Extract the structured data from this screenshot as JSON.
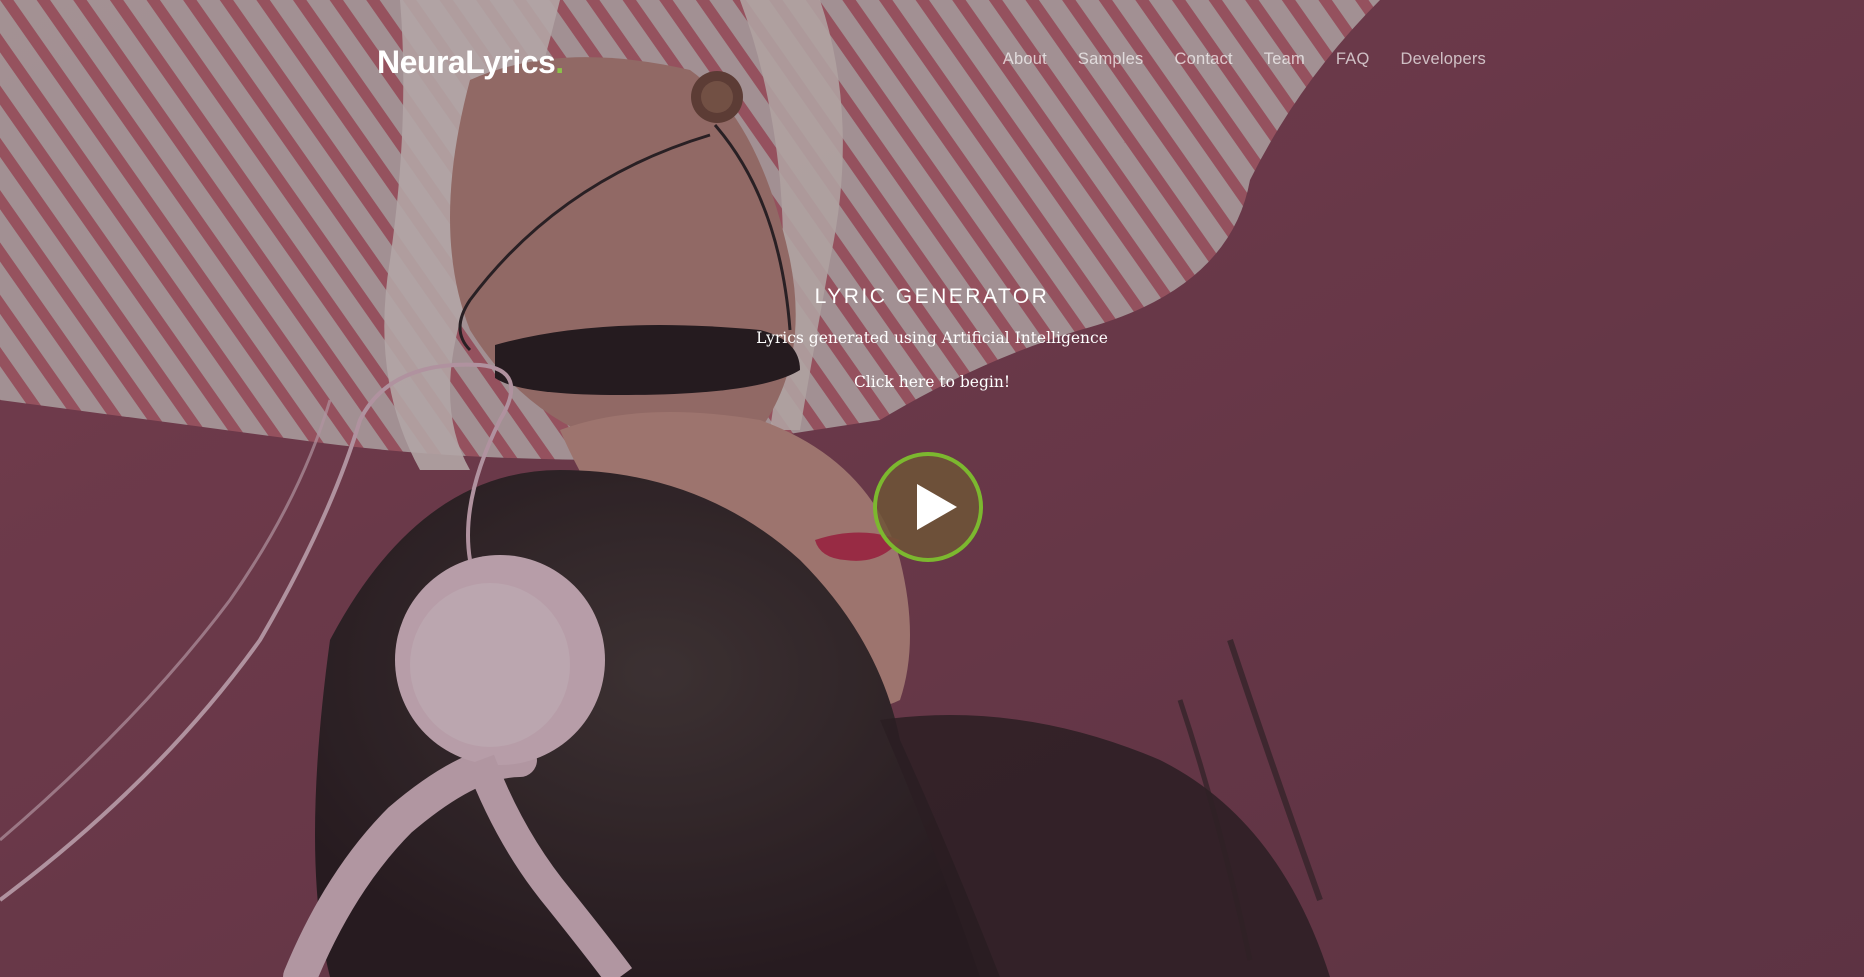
{
  "brand": {
    "name": "NeuraLyrics",
    "dot": "."
  },
  "nav": {
    "items": [
      {
        "label": "About"
      },
      {
        "label": "Samples"
      },
      {
        "label": "Contact"
      },
      {
        "label": "Team"
      },
      {
        "label": "FAQ"
      },
      {
        "label": "Developers"
      }
    ]
  },
  "hero": {
    "title": "LYRIC GENERATOR",
    "subtitle": "Lyrics generated using Artificial Intelligence",
    "cta": "Click here to begin!",
    "background_image": "girl-with-headphones-upside-down-on-pink-background"
  },
  "play_button": {
    "icon": "play-icon"
  },
  "colors": {
    "accent": "#8bc34a",
    "play_ring": "#7cb82f",
    "background": "#6b3d4f",
    "text": "#ffffff"
  }
}
